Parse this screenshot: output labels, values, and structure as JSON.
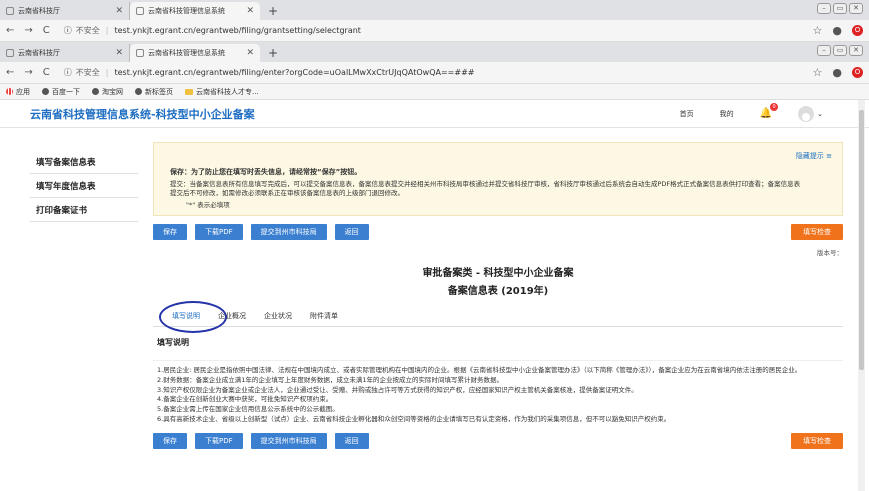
{
  "browser": {
    "tabs_window1": [
      {
        "title": "云南省科技厅"
      },
      {
        "title": "云南省科技管理信息系统"
      }
    ],
    "tabs_window2": [
      {
        "title": "云南省科技厅"
      },
      {
        "title": "云南省科技管理信息系统"
      }
    ],
    "url1": {
      "insecure": "不安全",
      "text": "test.ynkjt.egrant.cn/egrantweb/filing/grantsetting/selectgrant"
    },
    "url2": {
      "insecure": "不安全",
      "text": "test.ynkjt.egrant.cn/egrantweb/filing/enter?orgCode=uOalLMwXxCtrUJqQAtOwQA==###"
    },
    "bookmarks": [
      "应用",
      "百度一下",
      "淘宝网",
      "新标签页",
      "云南省科技人才专..."
    ]
  },
  "app": {
    "brand": "云南省科技管理信息系统-科技型中小企业备案",
    "nav_home": "首页",
    "nav_mine": "我的",
    "bell_count": "0"
  },
  "sidebar": {
    "items": [
      {
        "label": "填写备案信息表"
      },
      {
        "label": "填写年度信息表"
      },
      {
        "label": "打印备案证书"
      }
    ]
  },
  "notice": {
    "hide_label": "隐藏提示 ≡",
    "line1": "保存：为了防止您在填写时丢失信息，请经常按“保存”按钮。",
    "line2": "提交：当备案信息表所有信息填写完成后，可以提交备案信息表，备案信息表提交并经相关州市科技局审核通过并提交省科技厅审核，省科技厅审核通过后系统会自动生成PDF格式正式备案信息表供打印查看；备案信息表提交后不可修改，如需修改必须联系正在审核该备案信息表的上级部门退回修改。",
    "line3": "\"*\"  表示必填项"
  },
  "buttons": {
    "save": "保存",
    "download_pdf": "下载PDF",
    "submit": "提交到州市科技局",
    "back": "返回",
    "check": "填写检查"
  },
  "version_label": "版本号：",
  "form": {
    "title1": "审批备案类 - 科技型中小企业备案",
    "title2": "备案信息表 (2019年)",
    "tabs": [
      "填写说明",
      "企业概况",
      "企业状况",
      "附件清单"
    ],
    "section_title": "填写说明",
    "instructions": [
      "1.居民企业: 居民企业是指依照中国法律、法规在中国境内成立、或者实际管理机构在中国境内的企业。根据《云南省科技型中小企业备案管理办法》（以下简称《管理办法》），备案企业应为在云南省境内依法注册的居民企业。",
      "2.财务数据：备案企业成立满1年的企业填写上年度财务数据，成立未满1年的企业按成立的实际时间填写累计财务数据。",
      "3.知识产权仅限企业为备案企业或企业法人，企业通过受让、受赠、并购或独占许可等方式获得的知识产权，应经国家知识产权主管机关备案核准，提供备案证明文件。",
      "4.备案企业在创新创业大赛中获奖，可批免知识产权项约束。",
      "5.备案企业需上传在国家企业信用信息公示系统中的公示截图。",
      "6.具有高新技术企业、省级以上创新型（试点）企业、云南省科技企业孵化器和众创空间等资格的企业请填写已有认定资格，作为我们的采集项信息，但不可以豁免知识产权约束。"
    ]
  }
}
